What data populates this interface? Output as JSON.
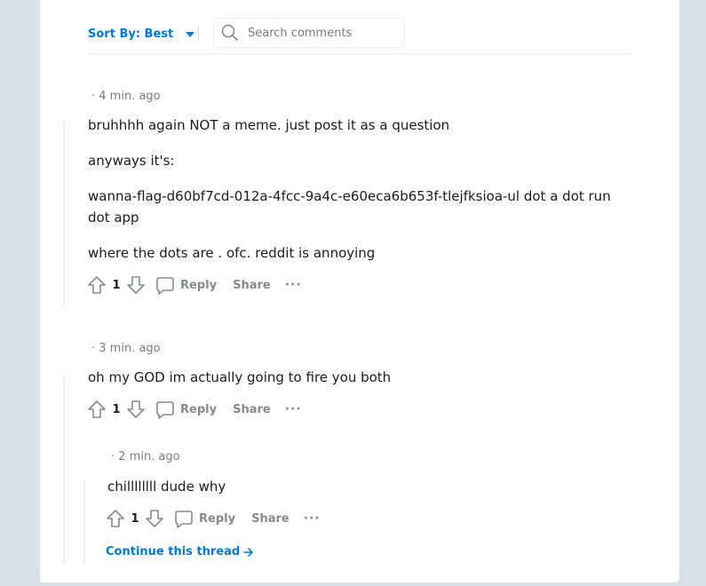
{
  "sort": {
    "label": "Sort By: Best"
  },
  "search": {
    "placeholder": "Search comments"
  },
  "comments": [
    {
      "meta": "· 4 min. ago",
      "paragraphs": [
        "bruhhhh again NOT a meme. just post it as a question",
        "anyways it's:",
        "wanna-flag-d60bf7cd-012a-4fcc-9a4c-e60eca6b653f-tlejfksioa-ul dot a dot run dot app",
        "where the dots are . ofc. reddit is annoying"
      ],
      "score": "1",
      "reply": "Reply",
      "share": "Share",
      "more": "···"
    },
    {
      "meta": "· 3 min. ago",
      "paragraphs": [
        "oh my GOD im actually going to fire you both"
      ],
      "score": "1",
      "reply": "Reply",
      "share": "Share",
      "more": "···"
    },
    {
      "meta": "· 2 min. ago",
      "paragraphs": [
        "chillllllll dude why"
      ],
      "score": "1",
      "reply": "Reply",
      "share": "Share",
      "more": "···"
    }
  ],
  "continue_thread": "Continue this thread",
  "icons": {
    "upvote": "upvote-icon",
    "downvote": "downvote-icon",
    "reply": "comment-icon",
    "search": "search-icon",
    "arrow": "arrow-right-icon"
  },
  "colors": {
    "accent": "#0079d3",
    "muted": "#878a8c",
    "background": "#dae0e6"
  }
}
